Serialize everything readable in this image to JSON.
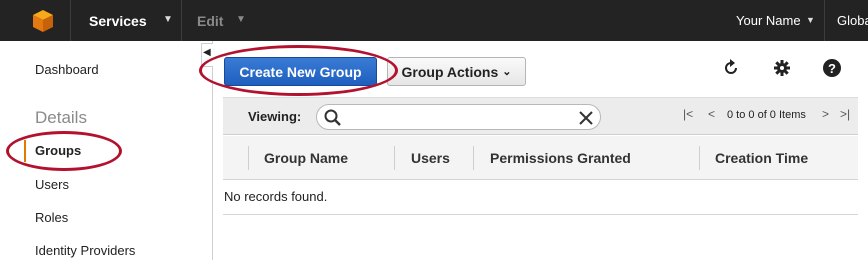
{
  "topbar": {
    "services_label": "Services",
    "edit_label": "Edit",
    "user_label": "Your Name",
    "region_label": "Global"
  },
  "sidebar": {
    "dashboard": "Dashboard",
    "section_heading": "Details",
    "items": [
      {
        "label": "Groups",
        "active": true
      },
      {
        "label": "Users",
        "active": false
      },
      {
        "label": "Roles",
        "active": false
      },
      {
        "label": "Identity Providers",
        "active": false
      }
    ]
  },
  "toolbar": {
    "create_label": "Create New Group",
    "actions_label": "Group Actions",
    "refresh_icon": "refresh-icon",
    "settings_icon": "gear-icon",
    "help_icon": "help-icon"
  },
  "filter": {
    "viewing_label": "Viewing:",
    "search_value": "",
    "pagination_text": "0 to 0 of 0 Items"
  },
  "table": {
    "columns": [
      "Group Name",
      "Users",
      "Permissions Granted",
      "Creation Time"
    ],
    "empty_message": "No records found."
  },
  "colors": {
    "topbar_bg": "#232323",
    "primary_button": "#2466c8",
    "highlight_ellipse": "#b3122e",
    "active_indicator": "#e07b00"
  }
}
